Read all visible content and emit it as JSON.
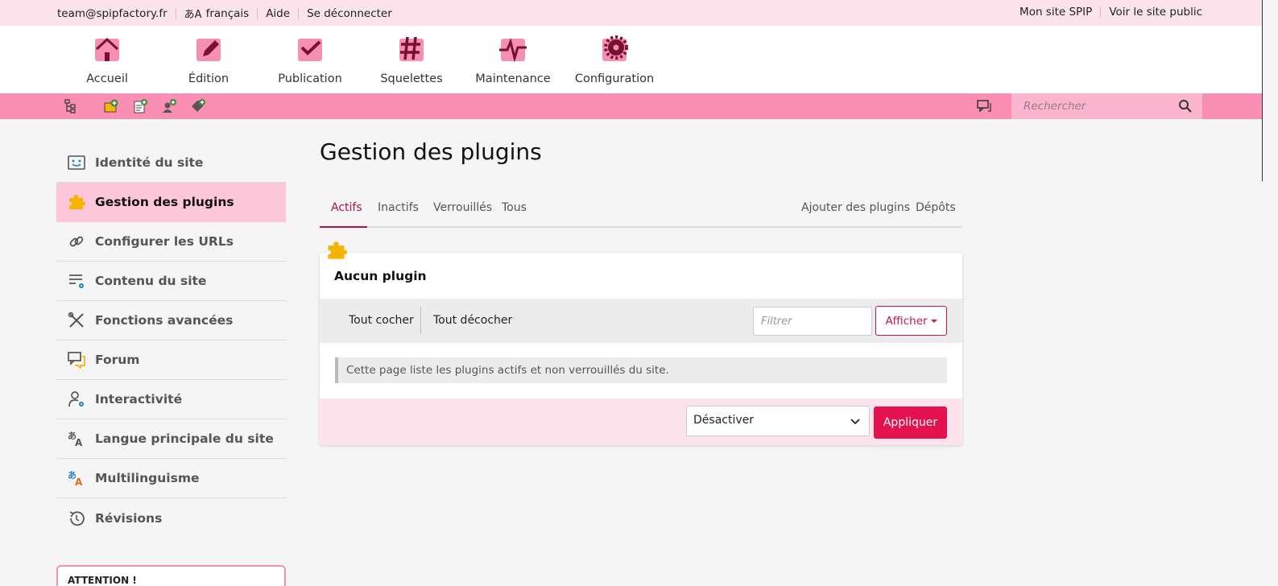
{
  "topbar": {
    "email": "team@spipfactory.fr",
    "lang_glyph": "あA",
    "language": "français",
    "help": "Aide",
    "logout": "Se déconnecter",
    "my_site": "Mon site SPIP",
    "public_site": "Voir le site public"
  },
  "mainnav": {
    "items": [
      {
        "label": "Accueil",
        "icon": "home-icon"
      },
      {
        "label": "Édition",
        "icon": "edit-icon"
      },
      {
        "label": "Publication",
        "icon": "check-icon"
      },
      {
        "label": "Squelettes",
        "icon": "hash-icon"
      },
      {
        "label": "Maintenance",
        "icon": "pulse-icon"
      },
      {
        "label": "Configuration",
        "icon": "gear-icon"
      }
    ]
  },
  "toolbar": {
    "search_placeholder": "Rechercher",
    "icons": [
      "site-tree-icon",
      "new-rubrique-icon",
      "new-article-icon",
      "new-author-icon",
      "new-keyword-icon",
      "messages-icon",
      "search-icon"
    ]
  },
  "sidebar": {
    "items": [
      {
        "label": "Identité du site",
        "icon": "identity-icon",
        "active": false
      },
      {
        "label": "Gestion des plugins",
        "icon": "puzzle-icon",
        "active": true
      },
      {
        "label": "Configurer les URLs",
        "icon": "link-icon",
        "active": false
      },
      {
        "label": "Contenu du site",
        "icon": "content-settings-icon",
        "active": false
      },
      {
        "label": "Fonctions avancées",
        "icon": "tools-icon",
        "active": false
      },
      {
        "label": "Forum",
        "icon": "forum-icon",
        "active": false
      },
      {
        "label": "Interactivité",
        "icon": "user-settings-icon",
        "active": false
      },
      {
        "label": "Langue principale du site",
        "icon": "language-icon",
        "active": false
      },
      {
        "label": "Multilinguisme",
        "icon": "multilang-icon",
        "active": false
      },
      {
        "label": "Révisions",
        "icon": "history-icon",
        "active": false
      }
    ],
    "attention": "ATTENTION !"
  },
  "main": {
    "title": "Gestion des plugins",
    "tabs": [
      {
        "label": "Actifs",
        "active": true
      },
      {
        "label": "Inactifs",
        "active": false
      },
      {
        "label": "Verrouillés",
        "active": false
      },
      {
        "label": "Tous",
        "active": false
      }
    ],
    "tabs_right": [
      {
        "label": "Ajouter des plugins"
      },
      {
        "label": "Dépôts"
      }
    ],
    "panel": {
      "title": "Aucun plugin",
      "check_all": "Tout cocher",
      "uncheck_all": "Tout décocher",
      "filter_placeholder": "Filtrer",
      "show_button": "Afficher",
      "notice": "Cette page liste les plugins actifs et non verrouillés du site.",
      "action_selected": "Désactiver",
      "apply_button": "Appliquer"
    }
  },
  "colors": {
    "accent": "#e6114f",
    "accent_dark": "#b3104a",
    "pink_light": "#fde4ec",
    "pink_mid": "#fb8fb3",
    "icon_dark": "#7a1030",
    "puzzle": "#f6b400"
  }
}
